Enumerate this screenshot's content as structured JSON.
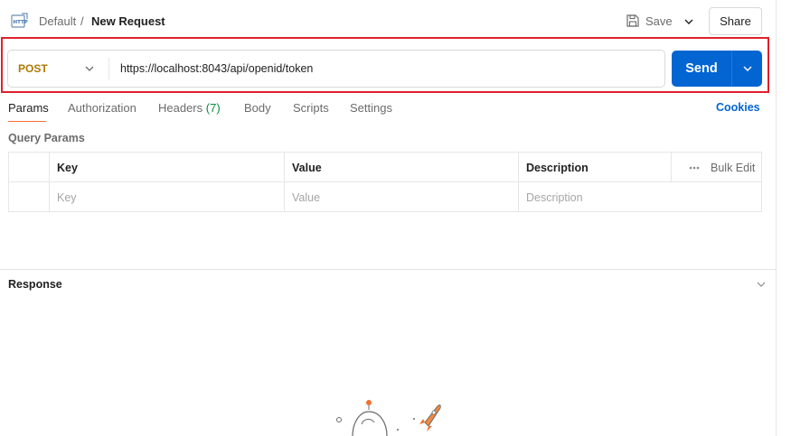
{
  "header": {
    "icon": "http-icon",
    "breadcrumb_parent": "Default",
    "breadcrumb_separator": "/",
    "title": "New Request",
    "save_label": "Save",
    "share_label": "Share"
  },
  "request": {
    "method": "POST",
    "url": "https://localhost:8043/api/openid/token",
    "send_label": "Send"
  },
  "tabs": [
    {
      "label": "Params",
      "active": true
    },
    {
      "label": "Authorization"
    },
    {
      "label": "Headers",
      "count": "(7)"
    },
    {
      "label": "Body"
    },
    {
      "label": "Scripts"
    },
    {
      "label": "Settings"
    }
  ],
  "cookies_label": "Cookies",
  "query_params": {
    "title": "Query Params",
    "columns": [
      "Key",
      "Value",
      "Description"
    ],
    "bulk_edit_label": "Bulk Edit",
    "placeholders": [
      "Key",
      "Value",
      "Description"
    ]
  },
  "response": {
    "title": "Response"
  },
  "colors": {
    "accent_blue": "#0265d2",
    "method_post": "#ad7a03",
    "highlight_red": "#e0202a",
    "active_tab_underline": "#ff6c37",
    "headers_count": "#0a8a3f"
  }
}
